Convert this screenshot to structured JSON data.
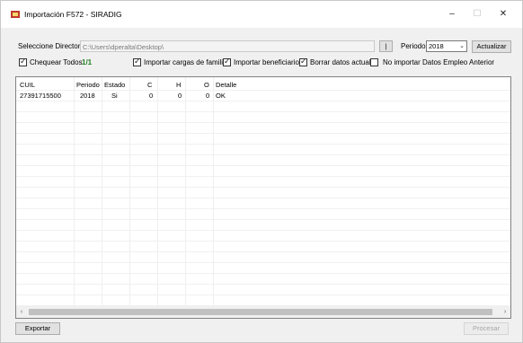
{
  "window": {
    "title": "Importación F572 - SIRADIG",
    "minimize": "–",
    "maximize": "☐",
    "close": "✕"
  },
  "toolbar": {
    "directory_label": "Seleccione Directorio",
    "directory_value": "C:\\Users\\dperalta\\Desktop\\",
    "browse_label": "|",
    "periodo_label": "Periodo",
    "periodo_value": "2018",
    "actualizar_label": "Actualizar"
  },
  "options": {
    "chequear_todos": {
      "label": "Chequear Todos",
      "checked": true
    },
    "count": "1/1",
    "importar_cargas": {
      "label": "Importar cargas de familia",
      "checked": true
    },
    "importar_beneficiarios": {
      "label": "Importar beneficiarios",
      "checked": true
    },
    "borrar_datos": {
      "label": "Borrar datos actuales",
      "checked": true
    },
    "no_importar": {
      "label": "No importar Datos Empleo Anterior",
      "checked": false
    }
  },
  "table": {
    "columns": [
      "CUIL",
      "Periodo",
      "Estado",
      "C",
      "H",
      "O",
      "Detalle"
    ],
    "rows": [
      [
        "27391715500",
        "2018",
        "Si",
        "0",
        "0",
        "0",
        "OK"
      ]
    ]
  },
  "scroll": {
    "left": "‹",
    "right": "›"
  },
  "footer": {
    "exportar_label": "Exportar",
    "procesar_label": "Procesar"
  }
}
